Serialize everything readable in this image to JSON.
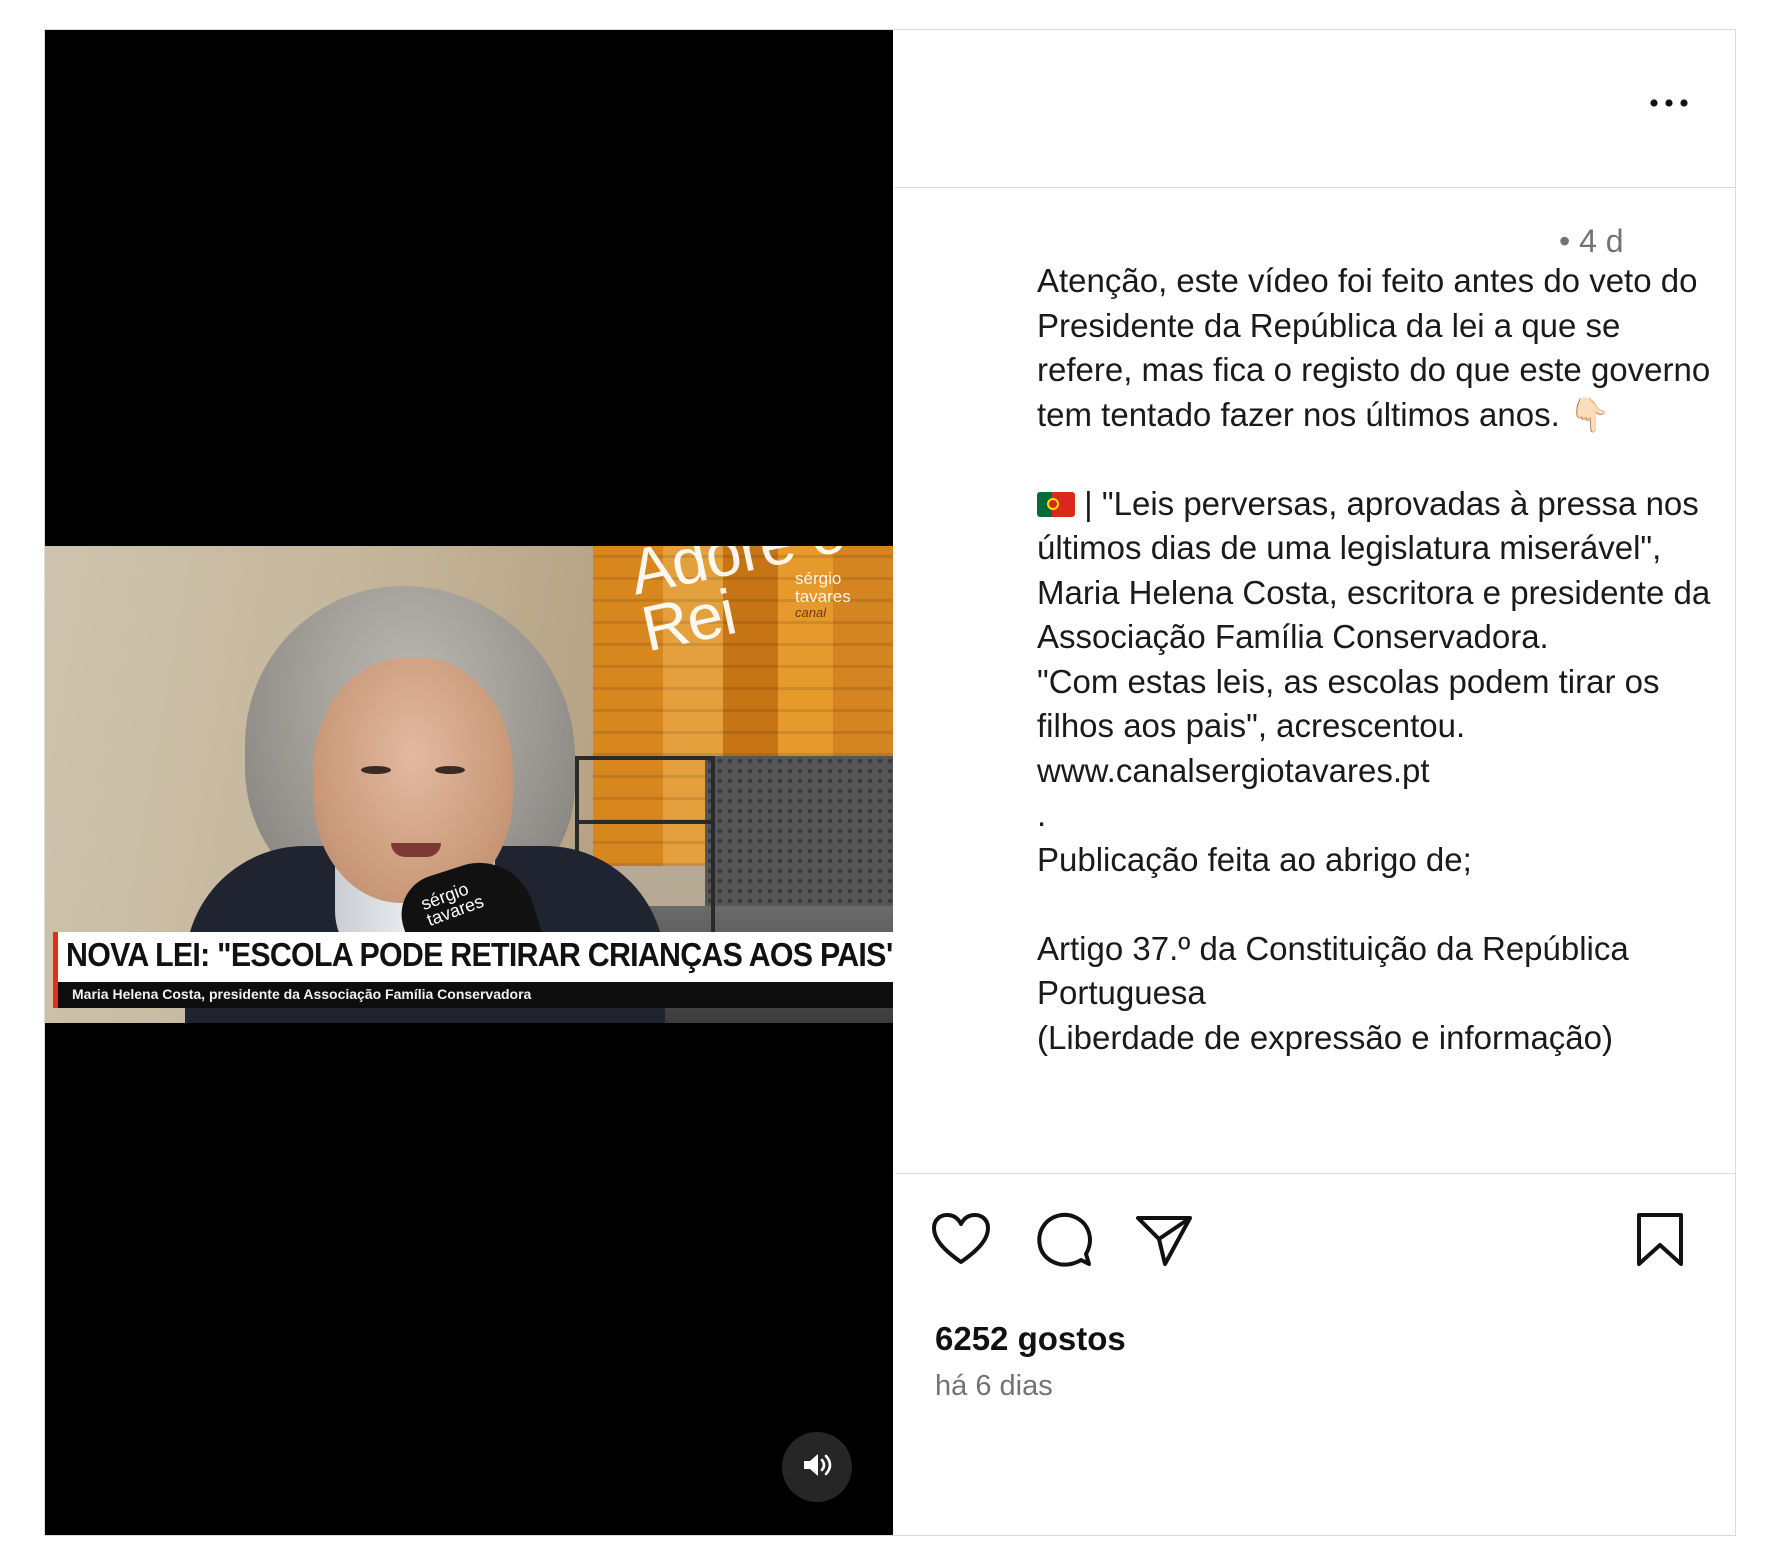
{
  "media": {
    "headline": "NOVA LEI: \"ESCOLA PODE RETIRAR CRIANÇAS AOS PAIS\"",
    "subtitle": "Maria Helena Costa, presidente da Associação Família Conservadora",
    "wall_sign": "Adore o Rei",
    "brand": {
      "line1": "sérgio",
      "line2": "tavares",
      "line3": "canal"
    },
    "mic_text": {
      "line1": "sérgio",
      "line2": "tavares"
    },
    "audio_icon": "speaker-icon"
  },
  "post": {
    "time_short": "• 4 d",
    "caption": {
      "part1": "Atenção, este vídeo foi feito antes do veto do Presidente da República da lei a que se refere, mas fica o registo do que este governo tem tentado fazer nos últimos anos. 👇🏻\n\n",
      "flag": "🇵🇹",
      "part2": "| \"Leis perversas, aprovadas à pressa nos últimos dias de uma legislatura miserável\", Maria Helena Costa, escritora e presidente da Associação Família Conservadora.\n\"Com estas leis, as escolas podem tirar os filhos aos pais\", acrescentou.\nwww.canalsergiotavares.pt\n.\nPublicação feita ao abrigo de;\n\nArtigo 37.º da Constituição da República Portuguesa\n(Liberdade de expressão e informação)"
    },
    "likes": "6252 gostos",
    "age": "há 6 dias"
  },
  "icons": {
    "more": "more-horizontal-icon",
    "like": "heart-icon",
    "comment": "comment-icon",
    "share": "send-icon",
    "save": "bookmark-icon"
  },
  "colors": {
    "accent_red": "#e0301e",
    "text_secondary": "#737373",
    "border": "#dbdbdb"
  }
}
